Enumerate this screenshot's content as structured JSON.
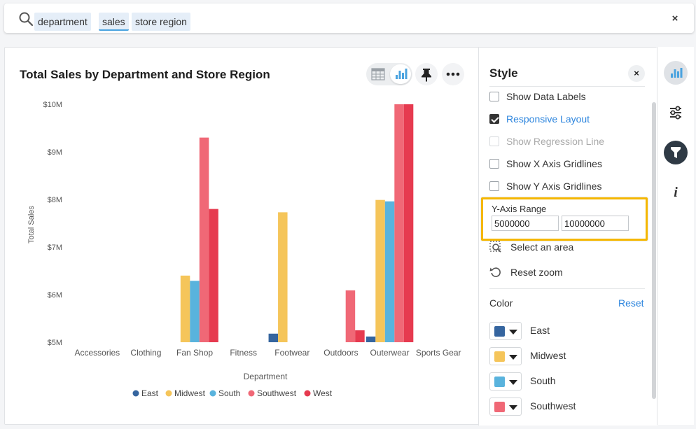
{
  "search": {
    "tokens": [
      "department",
      "sales",
      "store region"
    ],
    "clear_label": "×"
  },
  "chart_header": {
    "title": "Total Sales by Department and Store Region"
  },
  "chart_data": {
    "type": "bar",
    "title": "Total Sales by Department and Store Region",
    "xlabel": "Department",
    "ylabel": "Total Sales",
    "ylim": [
      5000000,
      10000000
    ],
    "y_ticks": [
      5000000,
      6000000,
      7000000,
      8000000,
      9000000,
      10000000
    ],
    "y_tick_labels": [
      "$5M",
      "$6M",
      "$7M",
      "$8M",
      "$9M",
      "$10M"
    ],
    "categories": [
      "Accessories",
      "Clothing",
      "Fan Shop",
      "Fitness",
      "Footwear",
      "Outdoors",
      "Outerwear",
      "Sports Gear"
    ],
    "series": [
      {
        "name": "East",
        "color": "#35659f",
        "values": [
          null,
          null,
          null,
          null,
          5180000,
          null,
          5120000,
          null
        ]
      },
      {
        "name": "Midwest",
        "color": "#f5c55a",
        "values": [
          null,
          null,
          6400000,
          null,
          7730000,
          null,
          7990000,
          null
        ]
      },
      {
        "name": "South",
        "color": "#59b3dd",
        "values": [
          null,
          null,
          6290000,
          null,
          null,
          null,
          7960000,
          null
        ]
      },
      {
        "name": "Southwest",
        "color": "#f06876",
        "values": [
          null,
          null,
          9300000,
          null,
          null,
          6090000,
          10000000,
          null
        ]
      },
      {
        "name": "West",
        "color": "#e63a4f",
        "values": [
          null,
          null,
          7800000,
          null,
          null,
          5250000,
          10000000,
          null
        ]
      }
    ],
    "legend_position": "bottom",
    "grid": false
  },
  "style_panel": {
    "title": "Style",
    "close_label": "×",
    "options": [
      {
        "label": "Show Data Labels",
        "checked": false,
        "disabled": false
      },
      {
        "label": "Responsive Layout",
        "checked": true,
        "disabled": false
      },
      {
        "label": "Show Regression Line",
        "checked": false,
        "disabled": true
      },
      {
        "label": "Show X Axis Gridlines",
        "checked": false,
        "disabled": false
      },
      {
        "label": "Show Y Axis Gridlines",
        "checked": false,
        "disabled": false
      }
    ],
    "y_axis_range": {
      "label": "Y-Axis Range",
      "min": "5000000",
      "max": "10000000"
    },
    "select_area_label": "Select an area",
    "reset_zoom_label": "Reset zoom",
    "color_label": "Color",
    "color_reset_label": "Reset",
    "colors": [
      {
        "name": "East",
        "color": "#35659f"
      },
      {
        "name": "Midwest",
        "color": "#f5c55a"
      },
      {
        "name": "South",
        "color": "#59b3dd"
      },
      {
        "name": "Southwest",
        "color": "#f06876"
      }
    ]
  },
  "rail": {
    "icons": [
      "chart-icon",
      "settings-sliders-icon",
      "filter-funnel-icon",
      "info-icon"
    ],
    "info_glyph": "i"
  },
  "toolbar": {
    "more_glyph": "•••"
  }
}
